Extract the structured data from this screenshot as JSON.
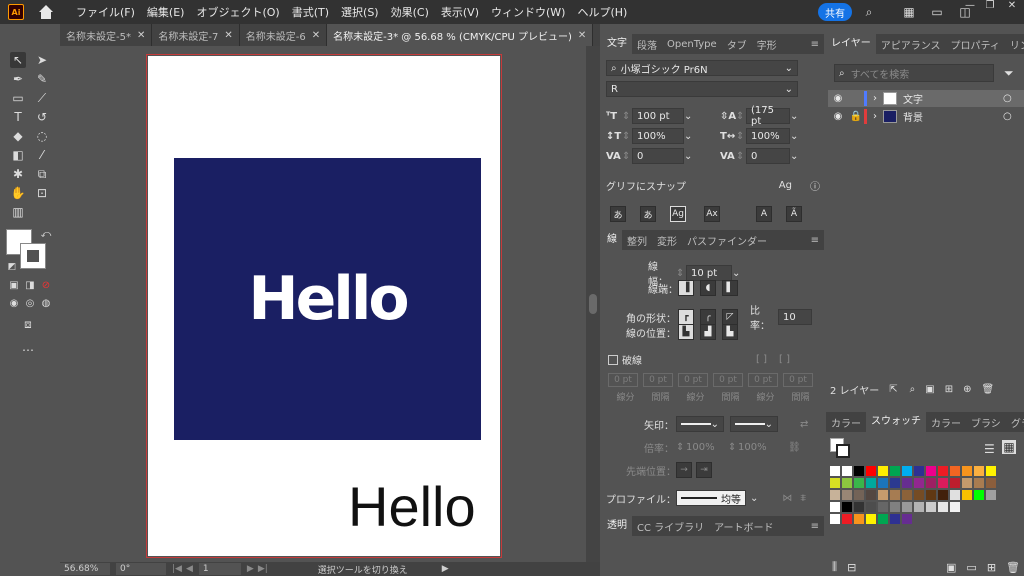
{
  "menu": {
    "logo": "Ai",
    "items": [
      "ファイル(F)",
      "編集(E)",
      "オブジェクト(O)",
      "書式(T)",
      "選択(S)",
      "効果(C)",
      "表示(V)",
      "ウィンドウ(W)",
      "ヘルプ(H)"
    ],
    "share_label": "共有"
  },
  "tabs": [
    {
      "label": "名称未設定-5*"
    },
    {
      "label": "名称未設定-7"
    },
    {
      "label": "名称未設定-6"
    },
    {
      "label": "名称未設定-3* @ 56.68 % (CMYK/CPU プレビュー)"
    }
  ],
  "artboard": {
    "hello_bold": "Hello",
    "hello_thin": "Hello",
    "rect_color": "#1a1f63"
  },
  "status": {
    "zoom": "56.68%",
    "rotation": "0°",
    "artboard_no": "1",
    "message": "選択ツールを切り換え"
  },
  "character": {
    "tabs": [
      "文字",
      "段落",
      "OpenType",
      "タブ",
      "字形"
    ],
    "font_family": "小塚ゴシック Pr6N",
    "font_style": "R",
    "font_size": "100 pt",
    "leading": "(175 pt",
    "vscale": "100%",
    "hscale": "100%",
    "kerning": "0",
    "tracking": "0",
    "snap_label": "グリフにスナップ"
  },
  "stroke": {
    "tabs": [
      "線",
      "整列",
      "変形",
      "パスファインダー"
    ],
    "weight_label": "線幅：",
    "weight": "10 pt",
    "cap_label": "線端：",
    "corner_label": "角の形状：",
    "limit_label": "比率：",
    "limit": "10",
    "align_label": "線の位置：",
    "dash_label": "破線",
    "dash_values": [
      "0 pt",
      "0 pt",
      "0 pt",
      "0 pt",
      "0 pt",
      "0 pt"
    ],
    "dash_labels": [
      "線分",
      "間隔",
      "線分",
      "間隔",
      "線分",
      "間隔"
    ],
    "arrow_label": "矢印：",
    "scale_label": "倍率：",
    "scale_a": "100%",
    "scale_b": "100%",
    "tip_label": "先端位置：",
    "profile_label": "プロファイル：",
    "profile_value": "均等"
  },
  "transparency": {
    "tabs": [
      "透明",
      "CC ライブラリ",
      "アートボード"
    ]
  },
  "layers": {
    "tabs": [
      "レイヤー",
      "アピアランス",
      "プロパティ",
      "リンク"
    ],
    "search_placeholder": "すべてを検索",
    "items": [
      {
        "name": "文字",
        "color": "#4f7bff"
      },
      {
        "name": "背景",
        "color": "#e03c3c"
      }
    ],
    "count_label": "2 レイヤー"
  },
  "swatches": {
    "tabs": [
      "カラー",
      "スウォッチ",
      "カラー",
      "ブラシ",
      "グラデ"
    ]
  }
}
